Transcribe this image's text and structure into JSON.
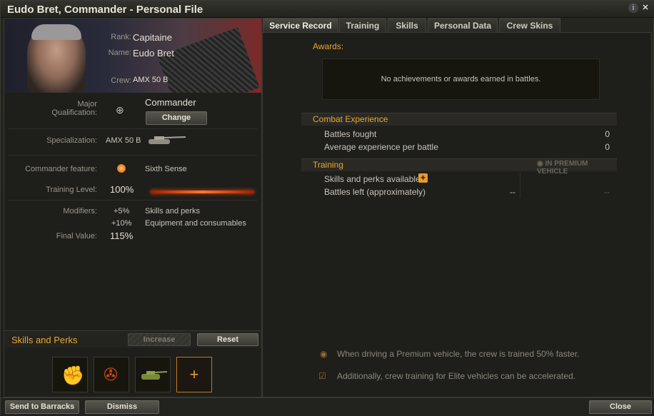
{
  "window": {
    "title": "Eudo Bret, Commander - Personal File"
  },
  "profile": {
    "rank_label": "Rank:",
    "rank": "Capitaine",
    "name_label": "Name:",
    "name": "Eudo Bret",
    "crew_label": "Crew:",
    "crew": "AMX 50 B"
  },
  "qualification": {
    "label_line1": "Major",
    "label_line2": "Qualification:",
    "value": "Commander",
    "change_label": "Change"
  },
  "specialization": {
    "label": "Specialization:",
    "value": "AMX 50 B"
  },
  "feature": {
    "label": "Commander feature:",
    "value": "Sixth Sense"
  },
  "training": {
    "label": "Training Level:",
    "value": "100%",
    "progress": 1.0
  },
  "modifiers": {
    "label": "Modifiers:",
    "skills_value": "+5%",
    "skills_text": "Skills and perks",
    "equip_value": "+10%",
    "equip_text": "Equipment and consumables"
  },
  "final": {
    "label": "Final Value:",
    "value": "115%"
  },
  "skills": {
    "title": "Skills and Perks",
    "increase_label": "Increase",
    "reset_label": "Reset",
    "slots": [
      "brothers-in-arms-icon",
      "repair-icon",
      "camouflage-icon"
    ],
    "add_label": "+"
  },
  "tabs": [
    "Service Record",
    "Training",
    "Skills",
    "Personal Data",
    "Crew Skins"
  ],
  "awards": {
    "title": "Awards:",
    "empty_text": "No achievements or awards earned in battles."
  },
  "combat": {
    "title": "Combat Experience",
    "rows": [
      {
        "label": "Battles fought",
        "value": "0"
      },
      {
        "label": "Average experience per battle",
        "value": "0"
      }
    ]
  },
  "training_section": {
    "title": "Training",
    "premium_label": "IN PREMIUM VEHICLE",
    "skills_label": "Skills and perks available",
    "battles_label": "Battles left (approximately)",
    "battles_value": "--",
    "premium_value": "--"
  },
  "notes": {
    "premium": "When driving a Premium vehicle, the crew is trained 50% faster.",
    "elite": "Additionally, crew training for Elite vehicles can be accelerated."
  },
  "footer": {
    "barracks": "Send to Barracks",
    "dismiss": "Dismiss",
    "close": "Close"
  },
  "colors": {
    "accent": "#e9a733",
    "bar": "#ff7a2a"
  }
}
